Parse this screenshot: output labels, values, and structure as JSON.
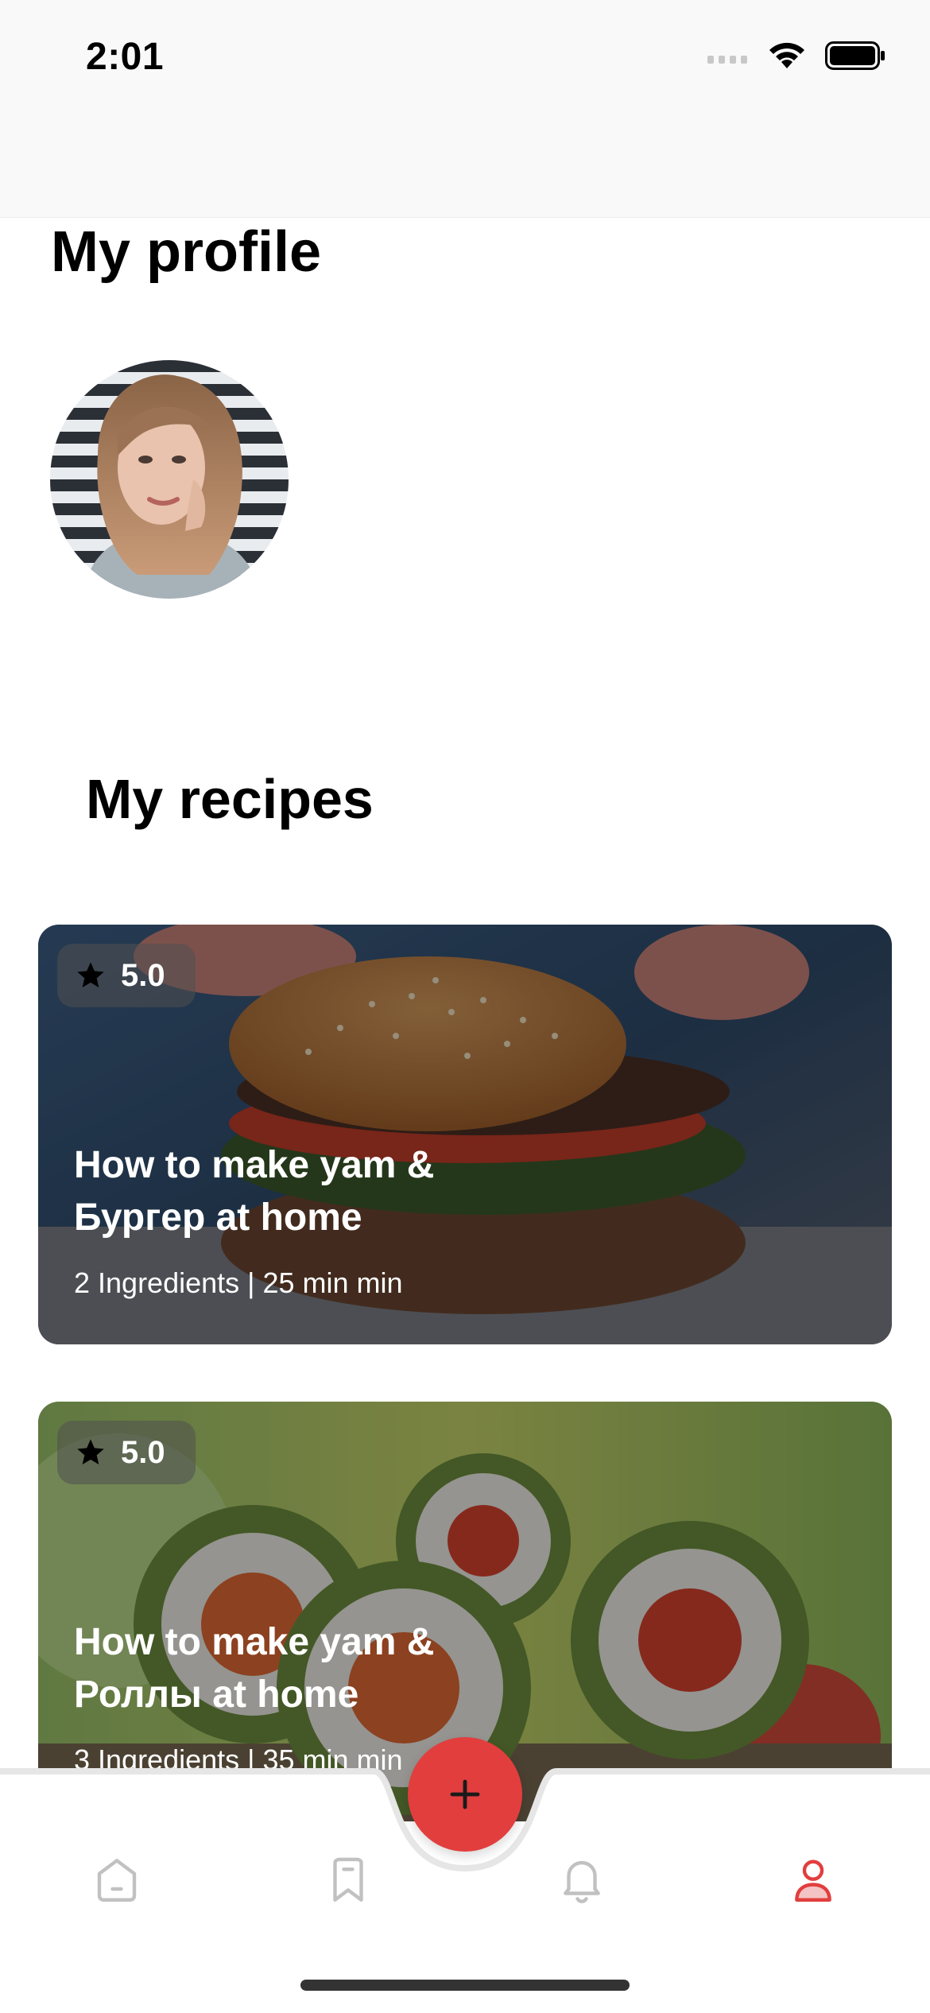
{
  "status_bar": {
    "time": "2:01"
  },
  "header": {
    "title": "My profile"
  },
  "profile": {
    "avatar_icon": "user-avatar-photo"
  },
  "recipes": {
    "section_title": "My recipes",
    "items": [
      {
        "rating": "5.0",
        "title": "How to make yam & Бургер at home",
        "meta": "2 Ingredients | 25 min min",
        "image": "burger-photo"
      },
      {
        "rating": "5.0",
        "title": "How to make yam & Роллы at home",
        "meta": "3 Ingredients | 35 min min",
        "image": "sushi-rolls-photo"
      }
    ]
  },
  "tab_bar": {
    "items": [
      {
        "icon": "home-icon",
        "active": false
      },
      {
        "icon": "bookmark-icon",
        "active": false
      },
      {
        "icon": "bell-icon",
        "active": false
      },
      {
        "icon": "profile-icon",
        "active": true
      }
    ],
    "fab_icon": "plus-icon"
  },
  "colors": {
    "accent": "#e23e3e",
    "inactive_icon": "#c1c1c1",
    "text": "#000000"
  }
}
